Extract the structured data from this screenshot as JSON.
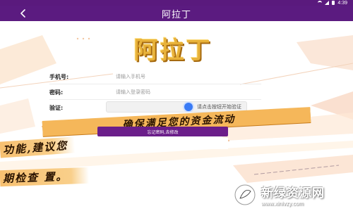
{
  "status_bar": {
    "time": "4:39",
    "icons": [
      "wifi-icon",
      "signal-icon",
      "battery-icon"
    ]
  },
  "header": {
    "back_icon": "chevron-left-icon",
    "title": "阿拉丁"
  },
  "logo": {
    "text": "阿拉丁"
  },
  "form": {
    "phone_label": "手机号:",
    "phone_placeholder": "请输入手机号",
    "password_label": "密码:",
    "password_placeholder": "请输入登录密码",
    "captcha_label": "验证:",
    "captcha_text": "请点击按钮开始验证"
  },
  "banner": {
    "text": ",确保满足您的资金流动"
  },
  "buttons": {
    "forgot_password": "忘记密码,去修改"
  },
  "overlay": {
    "line1": "功能,建议您",
    "line2": "期检查                  置。"
  },
  "watermark": {
    "name": "新绿资源网",
    "url": "www.xinlvzy.com"
  },
  "colors": {
    "header_bg": "#5b1b80",
    "accent_purple": "#6b1e8a",
    "banner_orange": "#f5b75a",
    "logo_gold": "#e8b23a",
    "captcha_blue": "#3a7bf5"
  }
}
